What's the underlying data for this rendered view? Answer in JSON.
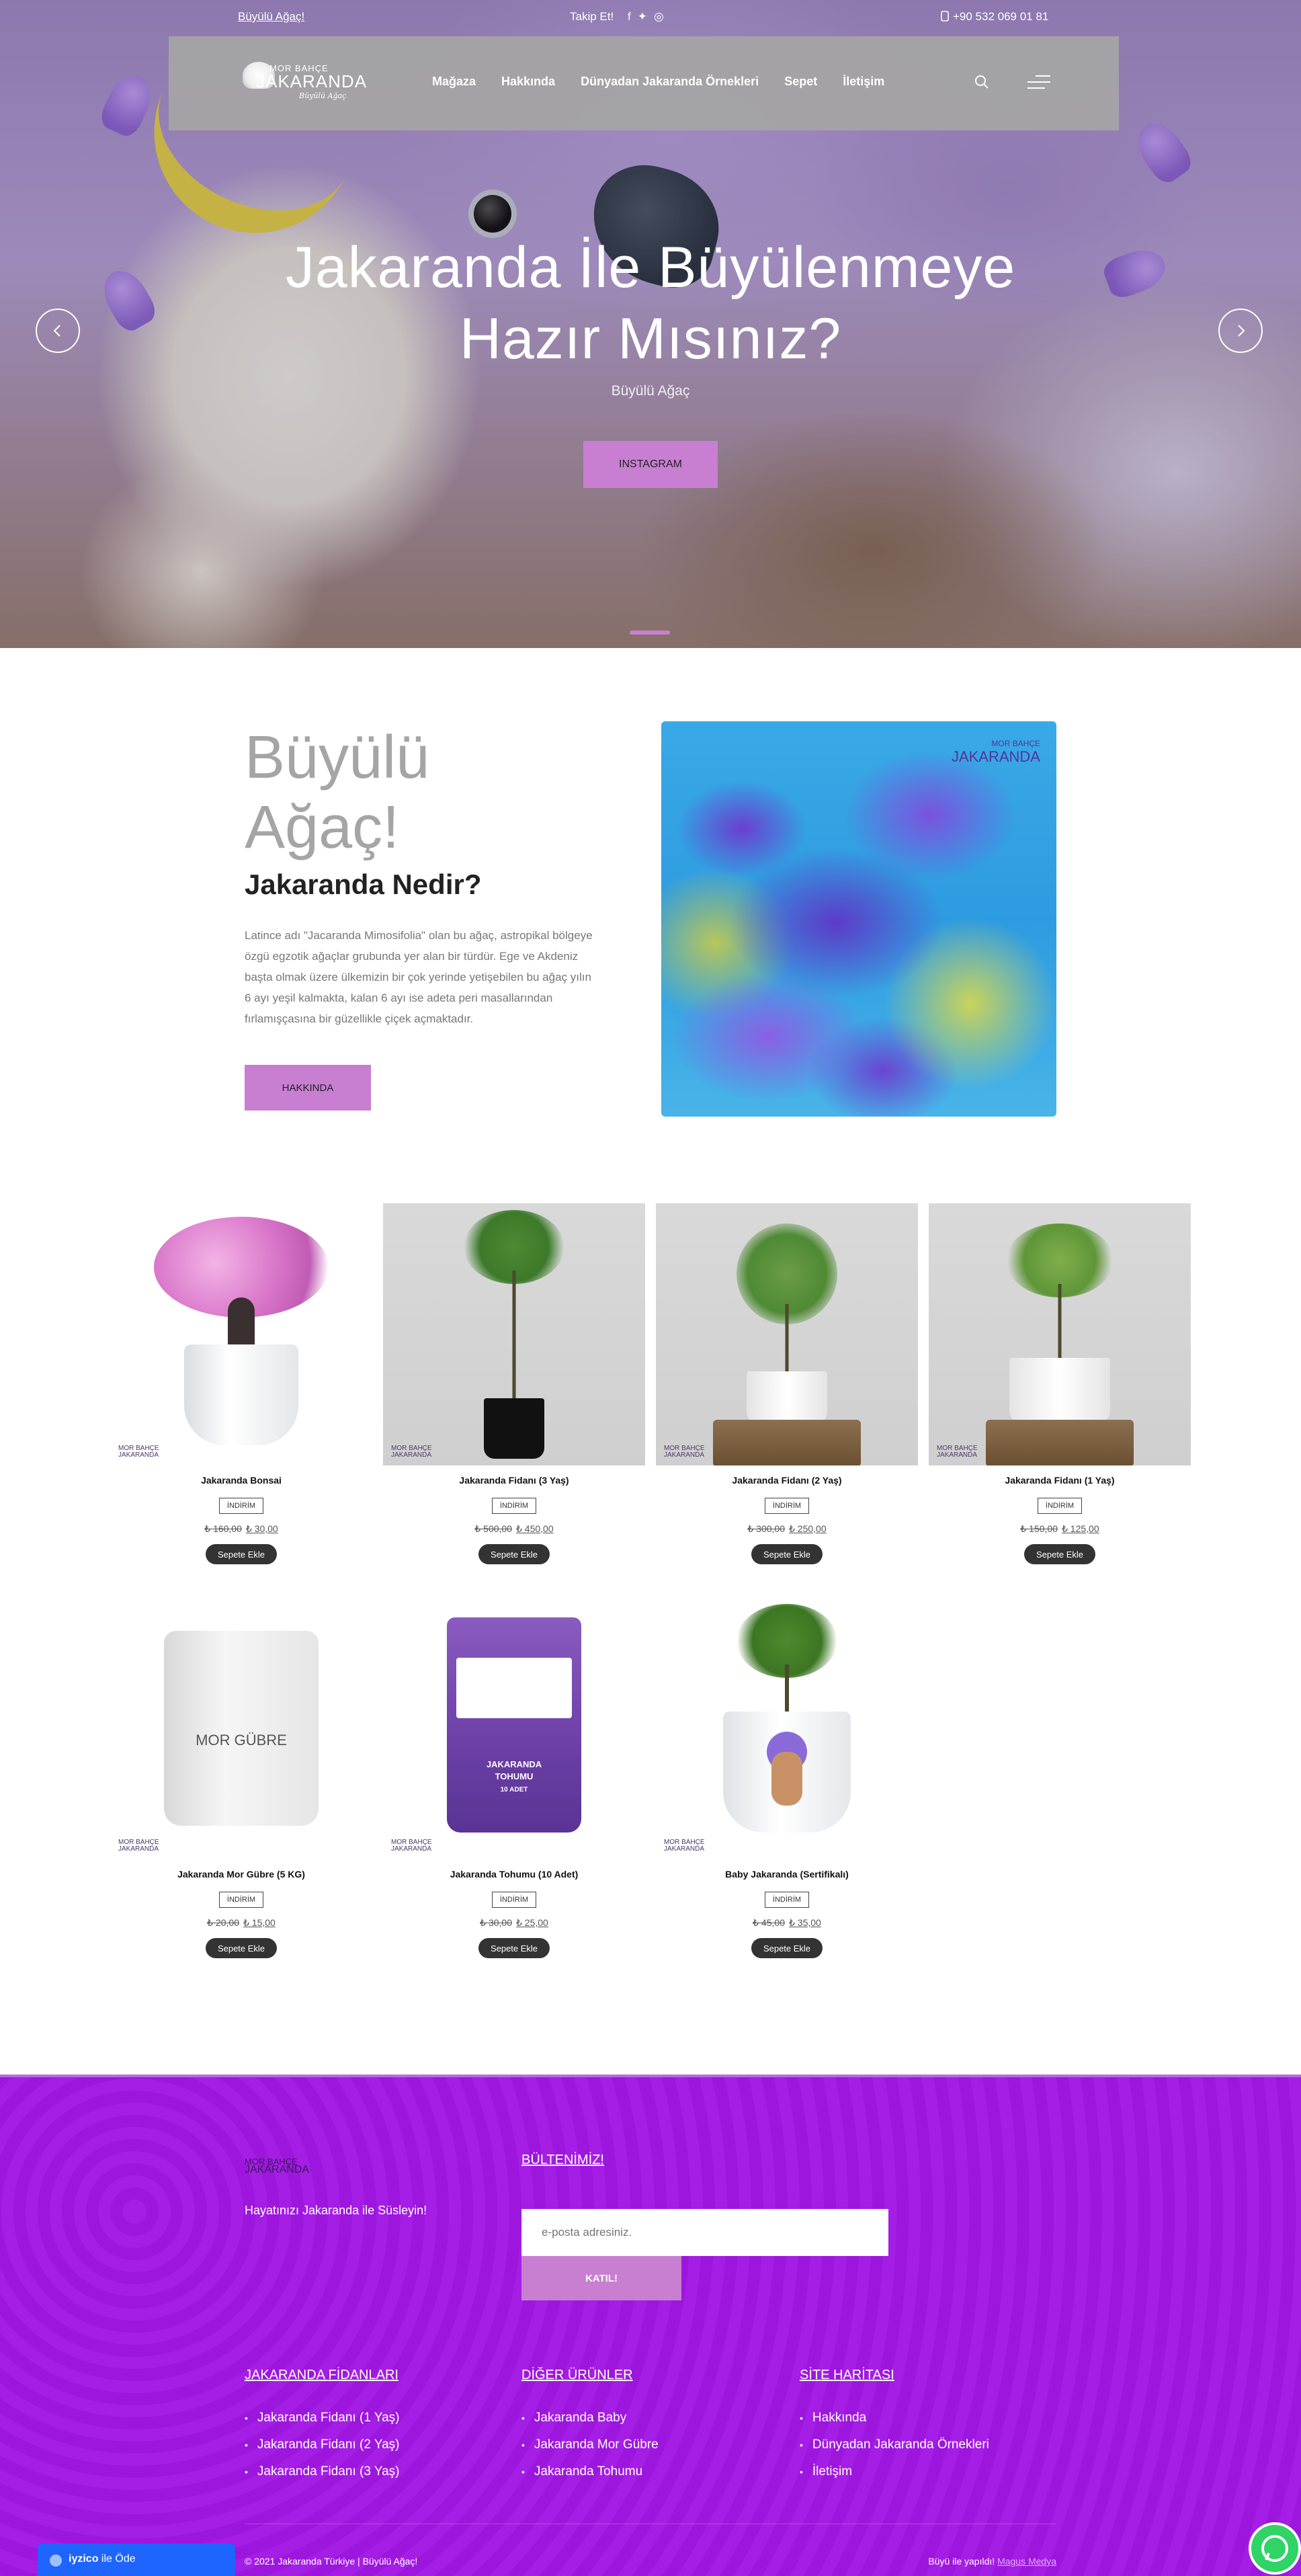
{
  "topbar": {
    "left_link": "Büyülü Ağaç!",
    "follow": "Takip Et!",
    "social_icons": [
      "facebook-icon",
      "twitter-icon",
      "instagram-icon"
    ],
    "phone": "+90 532 069 01 81"
  },
  "logo": {
    "line1": "MOR BAHÇE",
    "line2": "JAKARANDA",
    "line3": "Büyülü Ağaç"
  },
  "nav": {
    "items": [
      "Mağaza",
      "Hakkında",
      "Dünyadan Jakaranda Örnekleri",
      "Sepet",
      "İletişim"
    ]
  },
  "hero": {
    "title_line1": "Jakaranda İle Büyülenmeye",
    "title_line2": "Hazır Mısınız?",
    "subtitle": "Büyülü Ağaç",
    "button": "INSTAGRAM"
  },
  "about": {
    "title_line1": "Büyülü",
    "title_line2": "Ağaç!",
    "subtitle": "Jakaranda Nedir?",
    "text": "Latince adı \"Jacaranda Mimosifolia\" olan bu ağaç, astropikal bölgeye özgü egzotik ağaçlar grubunda yer alan bir türdür. Ege ve Akdeniz başta olmak üzere ülkemizin bir çok yerinde yetişebilen bu ağaç yılın 6 ayı yeşil kalmakta, kalan 6 ayı ise adeta peri masallarından fırlamışçasına bir güzellikle çiçek açmaktadır.",
    "button": "HAKKINDA"
  },
  "products": [
    {
      "name": "Jakaranda Bonsai",
      "badge": "İNDİRİM",
      "old_price": "₺ 160,00",
      "new_price": "₺ 30,00",
      "button": "Sepete Ekle"
    },
    {
      "name": "Jakaranda Fidanı (3 Yaş)",
      "badge": "İNDİRİM",
      "old_price": "₺ 500,00",
      "new_price": "₺ 450,00",
      "button": "Sepete Ekle"
    },
    {
      "name": "Jakaranda Fidanı (2 Yaş)",
      "badge": "İNDİRİM",
      "old_price": "₺ 300,00",
      "new_price": "₺ 250,00",
      "button": "Sepete Ekle"
    },
    {
      "name": "Jakaranda Fidanı (1 Yaş)",
      "badge": "İNDİRİM",
      "old_price": "₺ 150,00",
      "new_price": "₺ 125,00",
      "button": "Sepete Ekle"
    },
    {
      "name": "Jakaranda Mor Gübre (5 KG)",
      "badge": "İNDİRİM",
      "old_price": "₺ 20,00",
      "new_price": "₺ 15,00",
      "button": "Sepete Ekle"
    },
    {
      "name": "Jakaranda Tohumu (10 Adet)",
      "badge": "İNDİRİM",
      "old_price": "₺ 30,00",
      "new_price": "₺ 25,00",
      "button": "Sepete Ekle"
    },
    {
      "name": "Baby Jakaranda (Sertifikalı)",
      "badge": "İNDİRİM",
      "old_price": "₺ 45,00",
      "new_price": "₺ 35,00",
      "button": "Sepete Ekle"
    }
  ],
  "product_art": {
    "bag_label": "MOR GÜBRE",
    "seed_label_1": "JAKARANDA",
    "seed_label_2": "TOHUMU",
    "seed_label_3": "10 ADET"
  },
  "footer": {
    "tagline": "Hayatınızı Jakaranda ile Süsleyin!",
    "newsletter_title": "BÜLTENİMİZ!",
    "email_placeholder": "e-posta adresiniz.",
    "join_button": "KATIL!",
    "col1_title": "JAKARANDA FİDANLARI",
    "col1_items": [
      "Jakaranda Fidanı (1 Yaş)",
      "Jakaranda Fidanı (2 Yaş)",
      "Jakaranda Fidanı (3 Yaş)"
    ],
    "col2_title": "DİĞER ÜRÜNLER",
    "col2_items": [
      "Jakaranda Baby",
      "Jakaranda Mor Gübre",
      "Jakaranda Tohumu"
    ],
    "col3_title": "SİTE HARİTASI",
    "col3_items": [
      "Hakkında",
      "Dünyadan Jakaranda Örnekleri",
      "İletişim"
    ],
    "copyright": "© 2021 Jakaranda Türkiye | Büyülü Ağaç!",
    "credit_prefix": "Büyü ile yapıldı!",
    "credit_link": "Magus Medya"
  },
  "widgets": {
    "iyzico_brand": "iyzico",
    "iyzico_text": "ile Öde"
  },
  "colors": {
    "accent": "#c87fd2",
    "footer_bg": "#a217e4",
    "button_dark": "#333333"
  }
}
